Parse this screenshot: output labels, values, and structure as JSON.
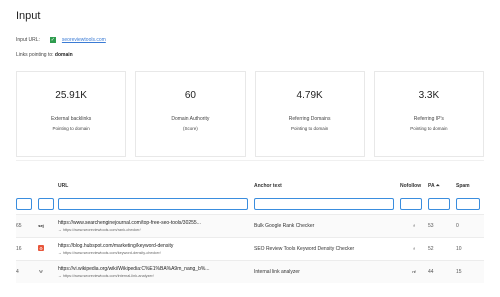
{
  "page": {
    "title": "Input"
  },
  "input": {
    "label": "Input URL:",
    "url": "seoreviewtools.com"
  },
  "links": {
    "label": "Links pointing to:",
    "value": "domain"
  },
  "cards": [
    {
      "value": "25.91K",
      "label": "External backlinks",
      "sub": "Pointing to domain"
    },
    {
      "value": "60",
      "label": "Domain Authority",
      "sub": "(Score)"
    },
    {
      "value": "4.79K",
      "label": "Referring Domains",
      "sub": "Pointing to domain"
    },
    {
      "value": "3.3K",
      "label": "Referring IP's",
      "sub": "Pointing to domain"
    }
  ],
  "table": {
    "headers": {
      "url": "URL",
      "anchor": "Anchor text",
      "nofollow": "Nofollow",
      "pa": "PA",
      "spam": "Spam"
    },
    "rows": [
      {
        "num": "65",
        "favicon": "sej-icon",
        "url": "https://www.searchenginejournal.com/top-free-seo-tools/30255...",
        "target": "→ https://www.seoreviewtools.com/rank-checker/",
        "anchor": "Bulk Google Rank Checker",
        "nofollow": "f",
        "pa": "53",
        "spam": "0"
      },
      {
        "num": "16",
        "favicon": "hubspot-icon",
        "url": "https://blog.hubspot.com/marketing/keyword-density",
        "target": "→ https://www.seoreviewtools.com/keyword-density-checker/",
        "anchor": "SEO Review Tools Keyword Density Checker",
        "nofollow": "f",
        "pa": "52",
        "spam": "10"
      },
      {
        "num": "4",
        "favicon": "wikipedia-icon",
        "url": "https://vi.wikipedia.org/wiki/Wikipedia:C%E1%BA%A9m_nang_b%...",
        "target": "→ https://www.seoreviewtools.com/internal-link-analyzer/",
        "anchor": "Internal link analyzer",
        "nofollow": "nf",
        "pa": "44",
        "spam": "15"
      }
    ]
  },
  "colors": {
    "accent": "#3a8dde",
    "check": "#2e9c4e",
    "hubspot": "#e8563a"
  }
}
